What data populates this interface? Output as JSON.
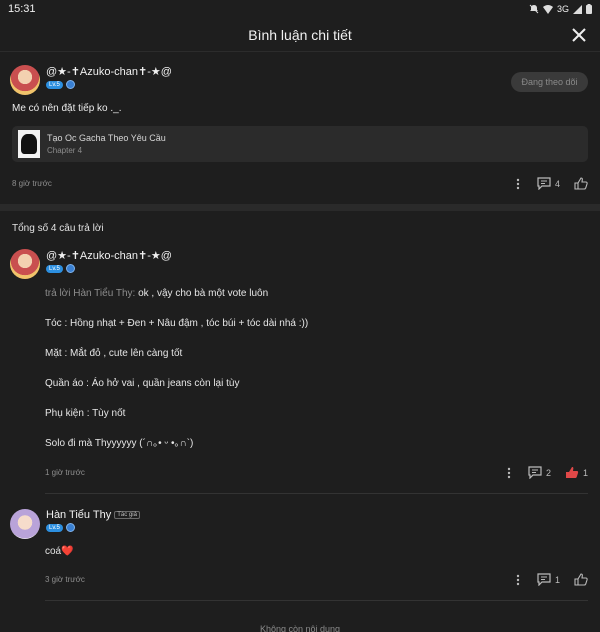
{
  "status_bar": {
    "time": "15:31",
    "network": "3G"
  },
  "header": {
    "title": "Bình luận chi tiết"
  },
  "main_comment": {
    "username": "@★-✝Azuko-chan✝-★@",
    "level": "Lv.5",
    "follow_label": "Đang theo dõi",
    "text": "Me có nên đặt tiếp ko ._.",
    "story": {
      "title": "Tạo Oc Gacha Theo Yêu Cầu",
      "chapter": "Chapter 4"
    },
    "time": "8 giờ trước",
    "reply_count": "4"
  },
  "total_replies": "Tổng số 4 câu trả lời",
  "replies": [
    {
      "username": "@★-✝Azuko-chan✝-★@",
      "level": "Lv.5",
      "reply_to": "trả lời Hàn Tiểu Thy:",
      "lines": [
        " ok , vậy cho bà một vote luôn",
        "Tóc : Hồng nhạt + Đen + Nâu đậm , tóc búi + tóc dài nhá :))",
        "Mặt : Mắt đỏ , cute lên càng tốt",
        "Quần áo : Áo hở vai , quần jeans còn lại tùy",
        "Phụ kiện : Tùy nốt",
        "Solo đi mà Thyyyyyy (´∩｡• ᵕ •｡∩`)"
      ],
      "time": "1 giờ trước",
      "reply_count": "2",
      "like_count": "1"
    },
    {
      "username": "Hàn Tiểu Thy",
      "author_tag": "Tác giả",
      "level": "Lv.5",
      "text": "coá❤️",
      "time": "3 giờ trước",
      "reply_count": "1"
    }
  ],
  "end_text": "Không còn nội dung",
  "colors": {
    "background": "#1e1e1e",
    "like_active": "#e04848",
    "level_badge": "#2c8fe0"
  }
}
